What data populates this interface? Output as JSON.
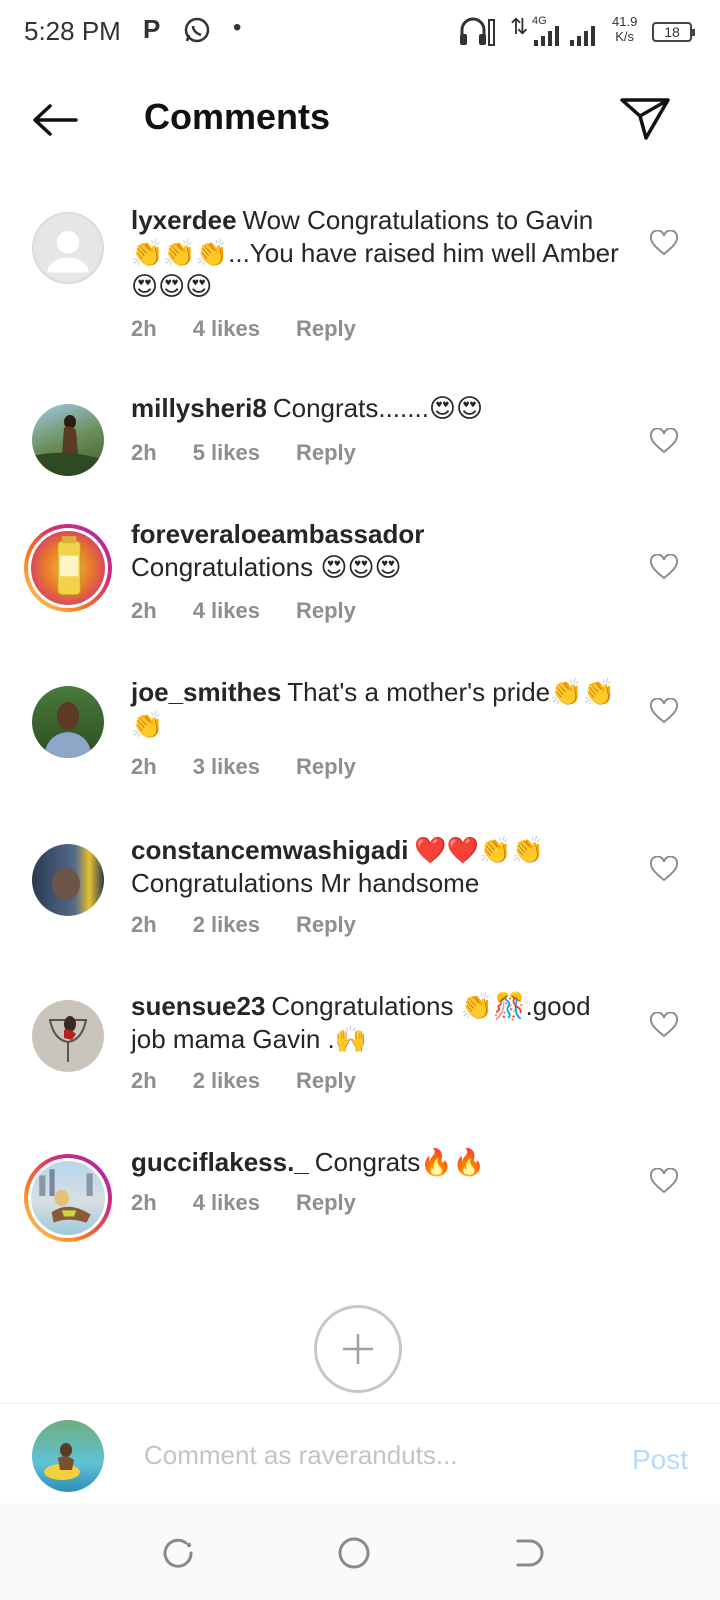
{
  "status_bar": {
    "time": "5:28 PM",
    "p_icon": "P",
    "network": "4G",
    "speed_value": "41.9",
    "speed_unit": "K/s",
    "battery": "18"
  },
  "header": {
    "title": "Comments",
    "back_icon": "arrow-left-icon",
    "share_icon": "paper-plane-icon"
  },
  "comments": [
    {
      "user": "lyxerdee",
      "text": "Wow Congratulations to Gavin 👏👏👏...You have raised him well Amber😍😍😍",
      "time": "2h",
      "likes": "4 likes",
      "reply": "Reply"
    },
    {
      "user": "millysheri8",
      "text": "Congrats.......😍😍",
      "time": "2h",
      "likes": "5 likes",
      "reply": "Reply"
    },
    {
      "user": "foreveraloeambassador",
      "text": "Congratulations 😍😍😍",
      "time": "2h",
      "likes": "4 likes",
      "reply": "Reply"
    },
    {
      "user": "joe_smithes",
      "text": "That's a mother's pride👏👏👏",
      "time": "2h",
      "likes": "3 likes",
      "reply": "Reply"
    },
    {
      "user": "constancemwashigadi",
      "text": "❤️❤️👏👏 Congratulations Mr handsome",
      "time": "2h",
      "likes": "2 likes",
      "reply": "Reply"
    },
    {
      "user": "suensue23",
      "text": "Congratulations 👏🎊.good job mama Gavin .🙌",
      "time": "2h",
      "likes": "2 likes",
      "reply": "Reply"
    },
    {
      "user": "gucciflakess._",
      "text": "Congrats🔥🔥",
      "time": "2h",
      "likes": "4 likes",
      "reply": "Reply"
    }
  ],
  "composer": {
    "placeholder": "Comment as raveranduts...",
    "post_label": "Post"
  },
  "accent_color": "#0095f6"
}
